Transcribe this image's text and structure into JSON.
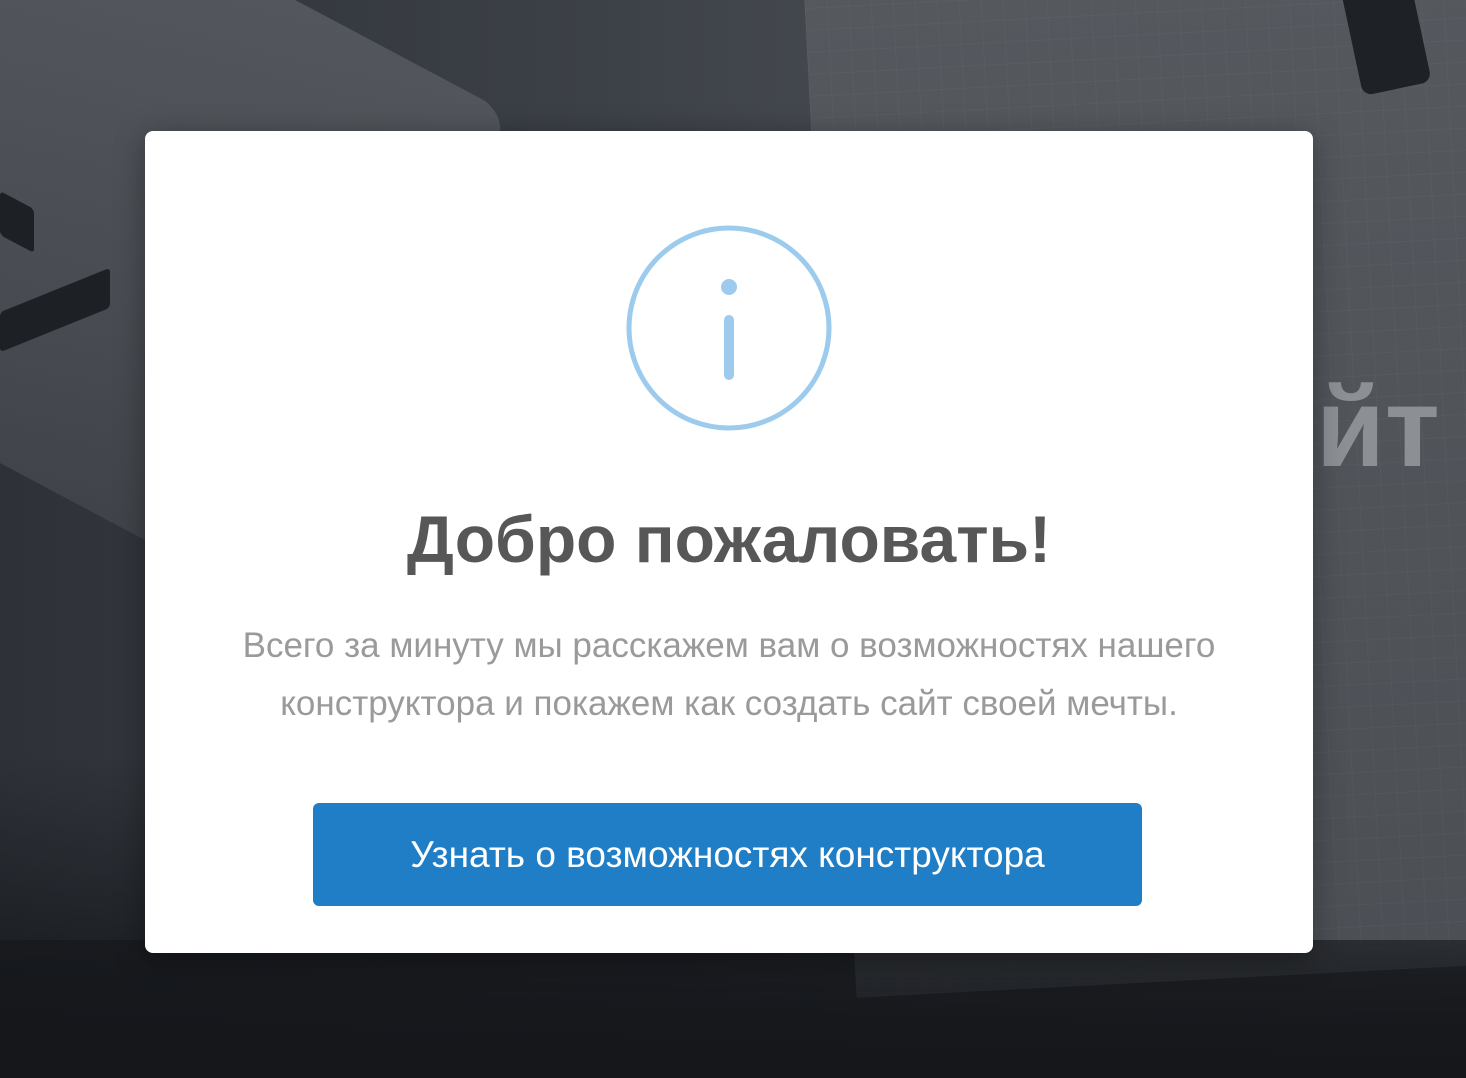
{
  "background": {
    "heading_fragment": "йт"
  },
  "modal": {
    "icon": "info-circle-icon",
    "icon_color": "#9ccbee",
    "title": "Добро пожаловать!",
    "text_lines": [
      "Всего за минуту мы расскажем вам о возможностях нашего",
      "конструктора и покажем как создать сайт своей мечты."
    ],
    "cta_label": "Узнать о возможностях конструктора",
    "cta_color": "#1f7ec5"
  }
}
